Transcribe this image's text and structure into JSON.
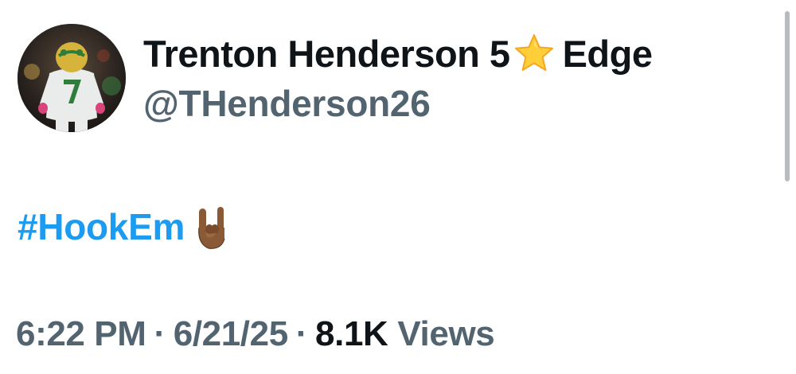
{
  "author": {
    "display_name": "Trenton Henderson 5",
    "badge_icon": "star-icon",
    "display_name_suffix": "Edge",
    "handle": "@THenderson26",
    "avatar_icon": "football-player-avatar"
  },
  "tweet": {
    "hashtag": "#HookEm",
    "emoji_icon": "horns-hand-icon"
  },
  "meta": {
    "time": "6:22 PM",
    "separator": "·",
    "date": "6/21/25",
    "views_count": "8.1K",
    "views_label": "Views"
  },
  "colors": {
    "text_primary": "#0f1419",
    "text_secondary": "#536471",
    "link": "#1d9bf0",
    "background": "#ffffff"
  }
}
